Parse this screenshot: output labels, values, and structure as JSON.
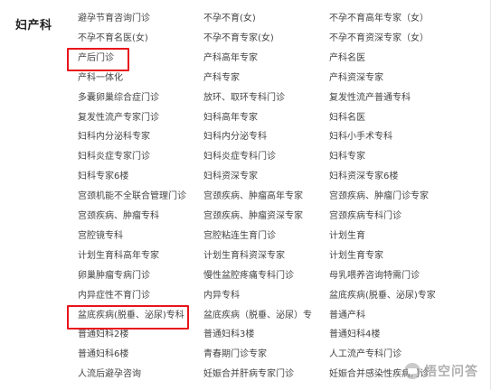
{
  "department": {
    "title": "妇产科"
  },
  "columns": [
    [
      "避孕节育咨询门诊",
      "不孕不育名医(女)",
      "产后门诊",
      "产科一体化",
      "多囊卵巢综合症门诊",
      "复发性流产专家门诊",
      "妇科内分泌科专家",
      "妇科炎症专家门诊",
      "妇科专家6楼",
      "宫颈机能不全联合管理门诊",
      "宫颈疾病、肿瘤专科",
      "宫腔镜专科",
      "计划生育科高年专家",
      "卵巢肿瘤专病门诊",
      "内异症性不育门诊",
      "盆底疾病(脱垂、泌尿)专科",
      "普通妇科2楼",
      "普通妇科6楼",
      "人流后避孕咨询"
    ],
    [
      "不孕不育(女)",
      "不孕不育专家(女)",
      "产科高年专家",
      "产科专家",
      "放环、取环专科门诊",
      "妇科高年专家",
      "妇科内分泌专科",
      "妇科炎症专科门诊",
      "妇科资深专家",
      "宫颈疾病、肿瘤高年专家",
      "宫颈疾病、肿瘤资深专家",
      "宫腔粘连生育门诊",
      "计划生育科资深专家",
      "慢性盆腔疼痛专科门诊",
      "内异专科",
      "盆底疾病（脱垂、泌尿）专",
      "普通妇科3楼",
      "青春期门诊专家",
      "妊娠合并肝病专家门诊"
    ],
    [
      "不孕不育高年专家（女）",
      "不孕不育资深专家（女）",
      "产科名医",
      "产科资深专家",
      "复发性流产普通专科",
      "妇科名医",
      "妇科小手术专科",
      "妇科专家",
      "妇科资深专家6楼",
      "宫颈疾病、肿瘤门诊专家",
      "宫颈疾病专科门诊",
      "计划生育",
      "计划生育专家",
      "母乳喂养咨询特需门诊",
      "盆底疾病(脱垂、泌尿)专家",
      "普通产科",
      "普通妇科4楼",
      "人工流产专科门诊",
      "妊娠合并感染性疾病门诊"
    ]
  ],
  "watermark": {
    "text": "悟空问答",
    "icon": "speech-bubble-icon"
  },
  "colors": {
    "highlight": "#e8141b",
    "link": "#444444",
    "title": "#222222"
  }
}
